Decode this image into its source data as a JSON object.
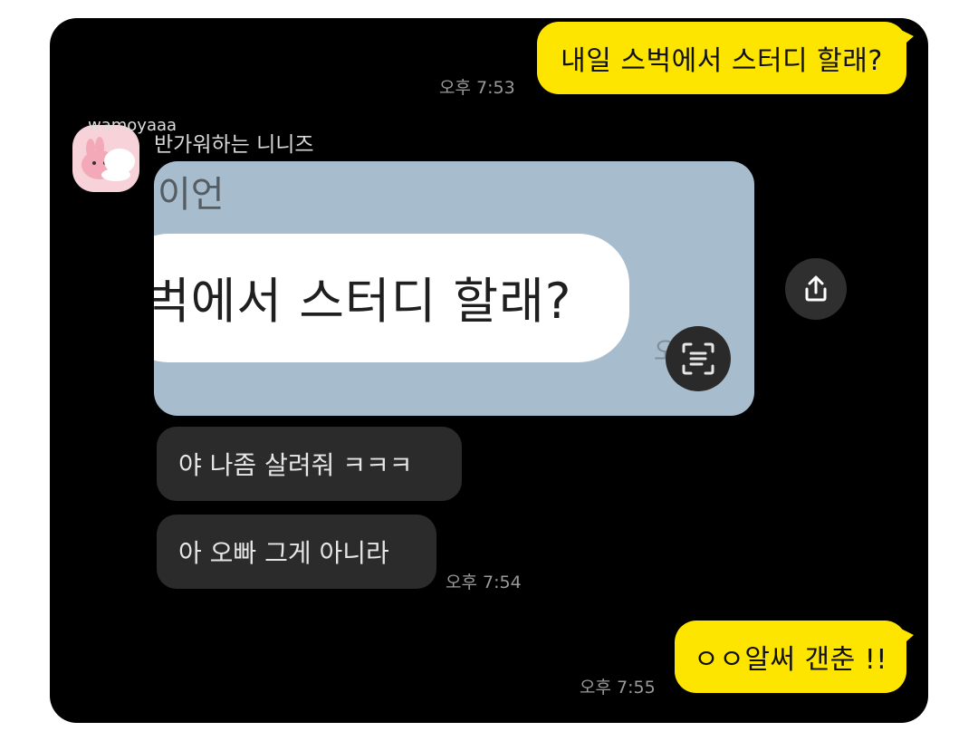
{
  "messages": {
    "m1": {
      "text": "내일 스벅에서 스터디 할래?",
      "time": "오후 7:53"
    },
    "m2": {
      "text": "야 나좀 살려줘 ㅋㅋㅋ"
    },
    "m3": {
      "text": "아 오빠 그게 아니라",
      "time": "오후 7:54"
    },
    "m4": {
      "text": "ㅇㅇ알써 갠춘 !!",
      "time": "오후 7:55"
    }
  },
  "sender": {
    "id": "wamoyaaa",
    "name": "반가워하는 니니즈"
  },
  "photo": {
    "partial_name": "이언",
    "text": "벅에서 스터디 할래?",
    "partial_time": "오 7:"
  },
  "icons": {
    "share": "share-icon",
    "scan": "text-scan-icon",
    "avatar": "pink-bunny-sticker"
  },
  "colors": {
    "my_bubble": "#fee500",
    "other_bubble": "#2b2b2b",
    "background": "#000000",
    "photo_bg": "#a7bccc"
  }
}
